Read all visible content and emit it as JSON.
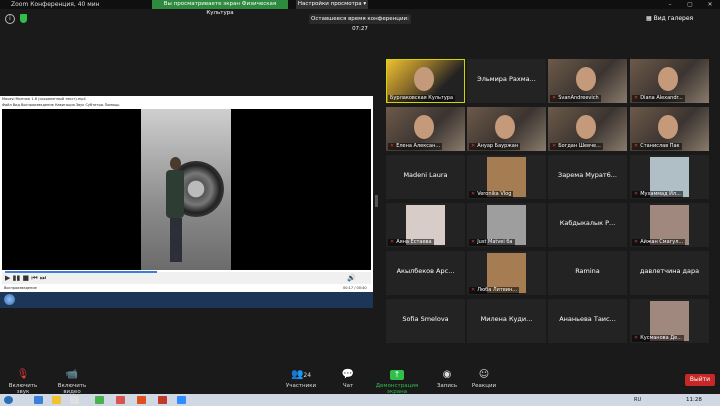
{
  "window": {
    "title": "Zoom Конференция, 40 мин",
    "banner": "Вы просматриваете экран Физическая Культура",
    "view_options": "Настройки просмотра ▾",
    "minimize": "–",
    "maximize": "▢",
    "close": "✕"
  },
  "info": {
    "time_left": "Оставшееся время конференции: 07:27",
    "gallery_view": "Вид галерея"
  },
  "shared": {
    "window_title": "Movavi Монтаж 1.6 (сохраненный текст).mp4",
    "menu": "Файл  Вид  Воспроизведение  Навигация  Звук  Субтитры  Помощь",
    "status": "Воспроизведение",
    "time": "00:17 / 00:40",
    "progress": 0.42
  },
  "participants": [
    {
      "label": "Бурлаковская Культура",
      "name": "",
      "type": "video",
      "active": true,
      "muted": false
    },
    {
      "label": "",
      "name": "Эльмира Рахма...",
      "type": "name",
      "muted": true
    },
    {
      "label": "SvanAndreevich",
      "name": "",
      "type": "video",
      "muted": true
    },
    {
      "label": "Diana Alexandr...",
      "name": "",
      "type": "video",
      "muted": true
    },
    {
      "label": "Елена Алексан...",
      "name": "",
      "type": "video",
      "muted": true
    },
    {
      "label": "Ануар Бауржан",
      "name": "",
      "type": "video",
      "muted": true
    },
    {
      "label": "Богдан Шевче...",
      "name": "",
      "type": "video",
      "muted": true
    },
    {
      "label": "Станислав Пак",
      "name": "",
      "type": "video",
      "muted": true
    },
    {
      "label": "",
      "name": "Madeni Laura",
      "type": "name",
      "muted": false
    },
    {
      "label": "Veronika Vlog",
      "name": "",
      "type": "photo",
      "muted": true
    },
    {
      "label": "",
      "name": "Зарема Мурат6...",
      "type": "name",
      "muted": false
    },
    {
      "label": "Мухаммад Ил...",
      "name": "",
      "type": "photo",
      "muted": true
    },
    {
      "label": "Аяна Естаева",
      "name": "",
      "type": "photo",
      "muted": true
    },
    {
      "label": "Just Matvei ба",
      "name": "",
      "type": "photo",
      "muted": true
    },
    {
      "label": "",
      "name": "Кабдыкалык Р...",
      "type": "name",
      "muted": false
    },
    {
      "label": "Айжан Смагул...",
      "name": "",
      "type": "photo",
      "muted": true
    },
    {
      "label": "",
      "name": "Акылбеков Арс...",
      "type": "name",
      "muted": false
    },
    {
      "label": "Люба Литвин...",
      "name": "",
      "type": "photo",
      "muted": true
    },
    {
      "label": "",
      "name": "Ramina",
      "type": "name",
      "muted": false
    },
    {
      "label": "",
      "name": "давлетчина дара",
      "type": "name",
      "muted": false
    },
    {
      "label": "",
      "name": "Sofia Smelova",
      "type": "name",
      "muted": false
    },
    {
      "label": "",
      "name": "Милена Куди...",
      "type": "name",
      "muted": false
    },
    {
      "label": "",
      "name": "Ананьева Таис...",
      "type": "name",
      "muted": false
    },
    {
      "label": "Кусманова Де...",
      "name": "",
      "type": "photo",
      "muted": true
    }
  ],
  "toolbar": {
    "unmute": "Включить звук",
    "start_video": "Включить видео",
    "participants": "Участники",
    "participants_count": "24",
    "chat": "Чат",
    "share": "Демонстрация экрана",
    "record": "Запись",
    "reactions": "Реакции",
    "leave": "Выйти"
  },
  "os": {
    "clock": "11:28",
    "lang": "RU"
  }
}
